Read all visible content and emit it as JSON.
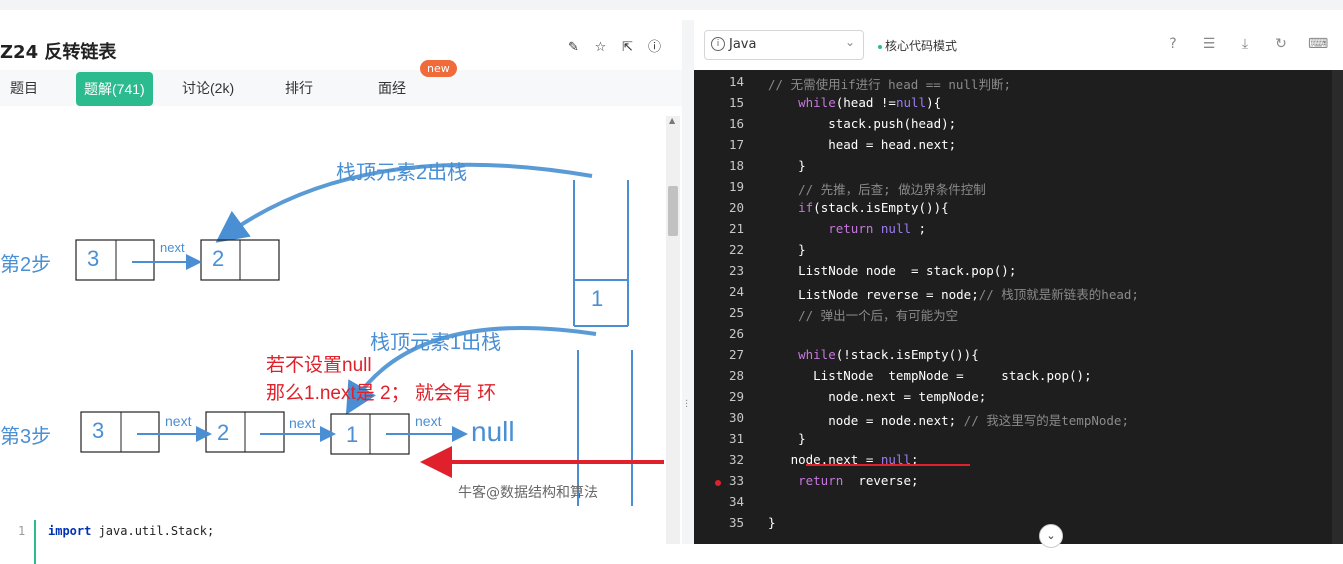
{
  "problem": {
    "title": "Z24  反转链表",
    "tabs": [
      "题目",
      "题解(741)",
      "讨论(2k)",
      "排行",
      "面经"
    ],
    "new_badge": "new"
  },
  "header_icons": [
    "edit-icon",
    "star-icon",
    "share-icon",
    "info-icon"
  ],
  "diagram": {
    "step2_label": "第2步",
    "step3_label": "第3步",
    "pop2_label": "栈顶元素2出栈",
    "pop1_label": "栈顶元素1出栈",
    "next_label": "next",
    "null_label": "null",
    "stack_value": "1",
    "step2_nodes": [
      "3",
      "2"
    ],
    "step3_nodes": [
      "3",
      "2",
      "1"
    ],
    "note_line1": "若不设置null",
    "note_line2": "那么1.next是 2；  就会有 环",
    "watermark": "牛客@数据结构和算法"
  },
  "left_code": {
    "line_no": "1",
    "keyword": "import",
    "text": " java.util.Stack;"
  },
  "editor": {
    "language": "Java",
    "mode": "核心代码模式",
    "toolbar_icons": [
      "help-icon",
      "list-icon",
      "download-icon",
      "refresh-icon",
      "keyboard-icon"
    ],
    "lines": [
      {
        "no": "14",
        "code": "// 无需使用if进行 head == null判断;"
      },
      {
        "no": "15",
        "code": "    while(head !=null){"
      },
      {
        "no": "16",
        "code": "        stack.push(head);"
      },
      {
        "no": "17",
        "code": "        head = head.next;"
      },
      {
        "no": "18",
        "code": "    }"
      },
      {
        "no": "19",
        "code": "    // 先推，后查; 做边界条件控制"
      },
      {
        "no": "20",
        "code": "    if(stack.isEmpty()){"
      },
      {
        "no": "21",
        "code": "        return null ;"
      },
      {
        "no": "22",
        "code": "    }"
      },
      {
        "no": "23",
        "code": "    ListNode node  = stack.pop();"
      },
      {
        "no": "24",
        "code": "    ListNode reverse = node;// 栈顶就是新链表的head;"
      },
      {
        "no": "25",
        "code": "    // 弹出一个后，有可能为空"
      },
      {
        "no": "26",
        "code": ""
      },
      {
        "no": "27",
        "code": "    while(!stack.isEmpty()){"
      },
      {
        "no": "28",
        "code": "      ListNode  tempNode =     stack.pop();"
      },
      {
        "no": "29",
        "code": "        node.next = tempNode;"
      },
      {
        "no": "30",
        "code": "        node = node.next; // 我这里写的是tempNode;"
      },
      {
        "no": "31",
        "code": "    }"
      },
      {
        "no": "32",
        "code": "   node.next = null;"
      },
      {
        "no": "33",
        "code": "    return  reverse;"
      },
      {
        "no": "34",
        "code": ""
      },
      {
        "no": "35",
        "code": "}"
      }
    ]
  }
}
